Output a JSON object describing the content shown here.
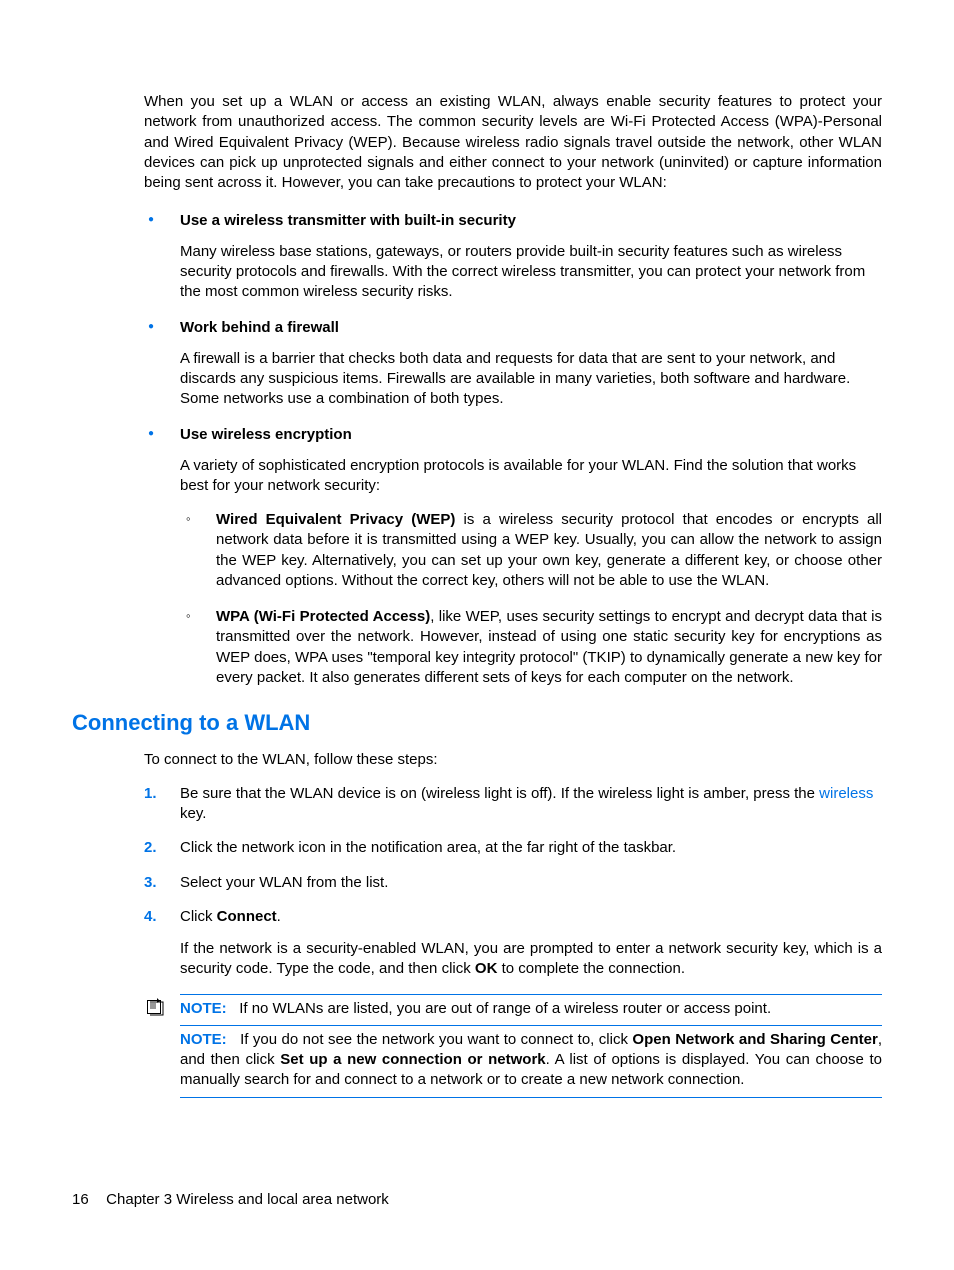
{
  "intro": "When you set up a WLAN or access an existing WLAN, always enable security features to protect your network from unauthorized access. The common security levels are Wi-Fi Protected Access (WPA)-Personal and Wired Equivalent Privacy (WEP). Because wireless radio signals travel outside the network, other WLAN devices can pick up unprotected signals and either connect to your network (uninvited) or capture information being sent across it. However, you can take precautions to protect your WLAN:",
  "bullets": {
    "b1": {
      "title": "Use a wireless transmitter with built-in security",
      "desc": "Many wireless base stations, gateways, or routers provide built-in security features such as wireless security protocols and firewalls. With the correct wireless transmitter, you can protect your network from the most common wireless security risks."
    },
    "b2": {
      "title": "Work behind a firewall",
      "desc": "A firewall is a barrier that checks both data and requests for data that are sent to your network, and discards any suspicious items. Firewalls are available in many varieties, both software and hardware. Some networks use a combination of both types."
    },
    "b3": {
      "title": "Use wireless encryption",
      "desc": "A variety of sophisticated encryption protocols is available for your WLAN. Find the solution that works best for your network security:",
      "sub": {
        "s1_bold": "Wired Equivalent Privacy (WEP)",
        "s1_rest": " is a wireless security protocol that encodes or encrypts all network data before it is transmitted using a WEP key. Usually, you can allow the network to assign the WEP key. Alternatively, you can set up your own key, generate a different key, or choose other advanced options. Without the correct key, others will not be able to use the WLAN.",
        "s2_bold": "WPA (Wi-Fi Protected Access)",
        "s2_rest": ", like WEP, uses security settings to encrypt and decrypt data that is transmitted over the network. However, instead of using one static security key for encryptions as WEP does, WPA uses \"temporal key integrity protocol\" (TKIP) to dynamically generate a new key for every packet. It also generates different sets of keys for each computer on the network."
      }
    }
  },
  "heading": "Connecting to a WLAN",
  "section_intro": "To connect to the WLAN, follow these steps:",
  "steps": {
    "s1_pre": "Be sure that the WLAN device is on (wireless light is off). If the wireless light is amber, press the ",
    "s1_link": "wireless",
    "s1_post": " key.",
    "s2": "Click the network icon in the notification area, at the far right of the taskbar.",
    "s3": "Select your WLAN from the list.",
    "s4_pre": "Click ",
    "s4_bold": "Connect",
    "s4_post": ".",
    "s4_follow_pre": "If the network is a security-enabled WLAN, you are prompted to enter a network security key, which is a security code. Type the code, and then click ",
    "s4_follow_bold": "OK",
    "s4_follow_post": " to complete the connection."
  },
  "notes": {
    "label": "NOTE:",
    "n1": "If no WLANs are listed, you are out of range of a wireless router or access point.",
    "n2_pre": "If you do not see the network you want to connect to, click ",
    "n2_b1": "Open Network and Sharing Center",
    "n2_mid": ", and then click ",
    "n2_b2": "Set up a new connection or network",
    "n2_post": ". A list of options is displayed. You can choose to manually search for and connect to a network or to create a new network connection."
  },
  "footer": {
    "page": "16",
    "chapter": "Chapter 3   Wireless and local area network"
  }
}
